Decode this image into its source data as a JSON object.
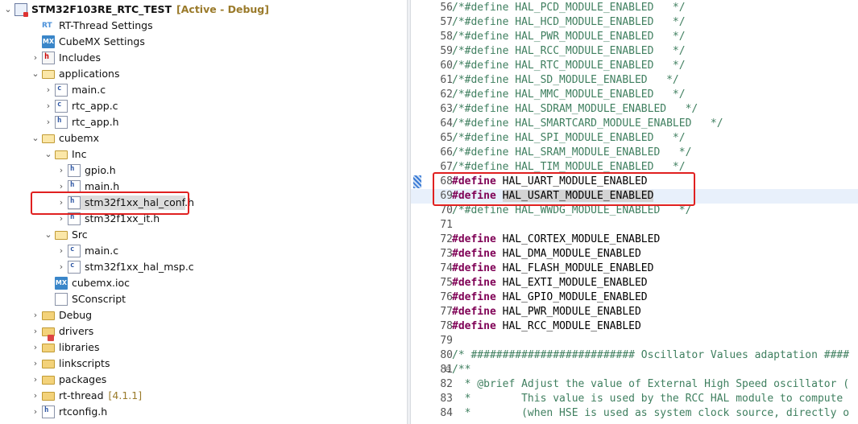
{
  "project_explorer": {
    "items": [
      {
        "label": "STM32F103RE_RTC_TEST",
        "extra": "[Active - Debug]",
        "icon": "project-icon",
        "twisty": "⌄"
      },
      {
        "label": "RT-Thread Settings",
        "icon": "rt-thread-settings-icon",
        "twisty": ""
      },
      {
        "label": "CubeMX Settings",
        "icon": "cubemx-icon",
        "twisty": ""
      },
      {
        "label": "Includes",
        "icon": "includes-icon",
        "twisty": "›"
      },
      {
        "label": "applications",
        "icon": "folder-open-icon",
        "twisty": "⌄"
      },
      {
        "label": "main.c",
        "icon": "c-file-icon",
        "twisty": "›"
      },
      {
        "label": "rtc_app.c",
        "icon": "c-file-icon",
        "twisty": "›"
      },
      {
        "label": "rtc_app.h",
        "icon": "h-file-icon",
        "twisty": "›"
      },
      {
        "label": "cubemx",
        "icon": "folder-open-icon",
        "twisty": "⌄"
      },
      {
        "label": "Inc",
        "icon": "folder-open-icon",
        "twisty": "⌄"
      },
      {
        "label": "gpio.h",
        "icon": "h-file-icon",
        "twisty": "›"
      },
      {
        "label": "main.h",
        "icon": "h-file-icon",
        "twisty": "›"
      },
      {
        "label": "stm32f1xx_hal_conf.h",
        "icon": "h-file-icon",
        "twisty": "›"
      },
      {
        "label": "stm32f1xx_it.h",
        "icon": "h-file-icon",
        "twisty": "›"
      },
      {
        "label": "Src",
        "icon": "folder-open-icon",
        "twisty": "⌄"
      },
      {
        "label": "main.c",
        "icon": "c-file-icon",
        "twisty": "›"
      },
      {
        "label": "stm32f1xx_hal_msp.c",
        "icon": "c-file-icon",
        "twisty": "›"
      },
      {
        "label": "cubemx.ioc",
        "icon": "cubemx-icon",
        "twisty": ""
      },
      {
        "label": "SConscript",
        "icon": "text-file-icon",
        "twisty": ""
      },
      {
        "label": "Debug",
        "icon": "folder-icon",
        "twisty": "›"
      },
      {
        "label": "drivers",
        "icon": "drivers-folder-icon",
        "twisty": "›"
      },
      {
        "label": "libraries",
        "icon": "folder-icon",
        "twisty": "›"
      },
      {
        "label": "linkscripts",
        "icon": "folder-icon",
        "twisty": "›"
      },
      {
        "label": "packages",
        "icon": "folder-icon",
        "twisty": "›"
      },
      {
        "label": "rt-thread",
        "extra": "[4.1.1]",
        "icon": "folder-icon",
        "twisty": "›"
      },
      {
        "label": "rtconfig.h",
        "icon": "h-file-icon",
        "twisty": "›"
      }
    ]
  },
  "editor": {
    "lines": [
      {
        "n": "56",
        "parts": [
          [
            "cmt",
            "/*#define HAL_PCD_MODULE_ENABLED   */"
          ]
        ]
      },
      {
        "n": "57",
        "parts": [
          [
            "cmt",
            "/*#define HAL_HCD_MODULE_ENABLED   */"
          ]
        ]
      },
      {
        "n": "58",
        "parts": [
          [
            "cmt",
            "/*#define HAL_PWR_MODULE_ENABLED   */"
          ]
        ]
      },
      {
        "n": "59",
        "parts": [
          [
            "cmt",
            "/*#define HAL_RCC_MODULE_ENABLED   */"
          ]
        ]
      },
      {
        "n": "60",
        "parts": [
          [
            "cmt",
            "/*#define HAL_RTC_MODULE_ENABLED   */"
          ]
        ]
      },
      {
        "n": "61",
        "parts": [
          [
            "cmt",
            "/*#define HAL_SD_MODULE_ENABLED   */"
          ]
        ]
      },
      {
        "n": "62",
        "parts": [
          [
            "cmt",
            "/*#define HAL_MMC_MODULE_ENABLED   */"
          ]
        ]
      },
      {
        "n": "63",
        "parts": [
          [
            "cmt",
            "/*#define HAL_SDRAM_MODULE_ENABLED   */"
          ]
        ]
      },
      {
        "n": "64",
        "parts": [
          [
            "cmt",
            "/*#define HAL_SMARTCARD_MODULE_ENABLED   */"
          ]
        ]
      },
      {
        "n": "65",
        "parts": [
          [
            "cmt",
            "/*#define HAL_SPI_MODULE_ENABLED   */"
          ]
        ]
      },
      {
        "n": "66",
        "parts": [
          [
            "cmt",
            "/*#define HAL_SRAM_MODULE_ENABLED   */"
          ]
        ]
      },
      {
        "n": "67",
        "parts": [
          [
            "cmt",
            "/*#define HAL_TIM_MODULE_ENABLED   */"
          ]
        ]
      },
      {
        "n": "68",
        "parts": [
          [
            "kw",
            "#define"
          ],
          [
            "plain",
            " HAL_UART_MODULE_ENABLED"
          ]
        ]
      },
      {
        "n": "69",
        "parts": [
          [
            "kw",
            "#define"
          ],
          [
            "plain",
            " "
          ],
          [
            "hlword",
            "HAL_USART_MODULE_ENABLED"
          ]
        ]
      },
      {
        "n": "70",
        "parts": [
          [
            "cmt",
            "/*#define HAL_WWDG_MODULE_ENABLED   */"
          ]
        ]
      },
      {
        "n": "71",
        "parts": []
      },
      {
        "n": "72",
        "parts": [
          [
            "kw",
            "#define"
          ],
          [
            "plain",
            " HAL_CORTEX_MODULE_ENABLED"
          ]
        ]
      },
      {
        "n": "73",
        "parts": [
          [
            "kw",
            "#define"
          ],
          [
            "plain",
            " HAL_DMA_MODULE_ENABLED"
          ]
        ]
      },
      {
        "n": "74",
        "parts": [
          [
            "kw",
            "#define"
          ],
          [
            "plain",
            " HAL_FLASH_MODULE_ENABLED"
          ]
        ]
      },
      {
        "n": "75",
        "parts": [
          [
            "kw",
            "#define"
          ],
          [
            "plain",
            " HAL_EXTI_MODULE_ENABLED"
          ]
        ]
      },
      {
        "n": "76",
        "parts": [
          [
            "kw",
            "#define"
          ],
          [
            "plain",
            " HAL_GPIO_MODULE_ENABLED"
          ]
        ]
      },
      {
        "n": "77",
        "parts": [
          [
            "kw",
            "#define"
          ],
          [
            "plain",
            " HAL_PWR_MODULE_ENABLED"
          ]
        ]
      },
      {
        "n": "78",
        "parts": [
          [
            "kw",
            "#define"
          ],
          [
            "plain",
            " HAL_RCC_MODULE_ENABLED"
          ]
        ]
      },
      {
        "n": "79",
        "parts": []
      },
      {
        "n": "80",
        "parts": [
          [
            "cmt",
            "/* ########################## Oscillator Values adaptation ####"
          ]
        ]
      },
      {
        "n": "81",
        "fold": "⊖",
        "parts": [
          [
            "cmt",
            "/**"
          ]
        ]
      },
      {
        "n": "82",
        "parts": [
          [
            "cmt",
            "  * @brief Adjust the value of External High Speed oscillator ("
          ]
        ]
      },
      {
        "n": "83",
        "parts": [
          [
            "cmt",
            "  *        This value is used by the RCC HAL module to compute"
          ]
        ]
      },
      {
        "n": "84",
        "parts": [
          [
            "cmt",
            "  *        (when HSE is used as system clock source, directly o"
          ]
        ]
      }
    ]
  },
  "colors": {
    "annotation_box": "#e02020",
    "keyword": "#7f0055",
    "comment": "#3f7f5f",
    "current_line": "#e8f0fb"
  }
}
